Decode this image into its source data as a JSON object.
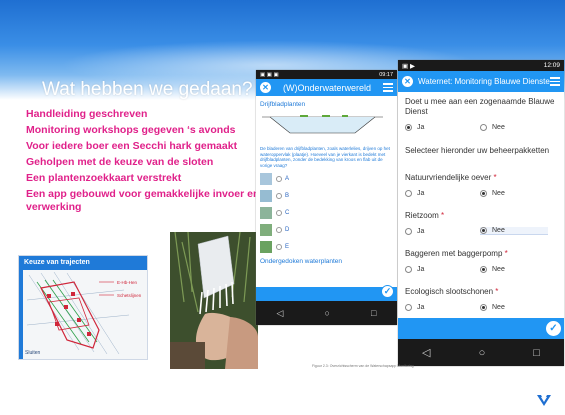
{
  "slide": {
    "title": "Wat hebben we gedaan?",
    "bullets": [
      "Handleiding geschreven",
      "Monitoring workshops gegeven ‘s avonds",
      "Voor iedere boer een Secchi hark gemaakt",
      "Geholpen met de keuze van de sloten",
      "Een plantenzoekkaart verstrekt",
      "Een app gebouwd voor gemakkelijke invoer en verwerking"
    ],
    "caption": "Figuur 2.3: Overzichtsscherm van de Waterschapsapp Monitoring",
    "colors": {
      "accent": "#e0218a",
      "band": "#1f6fd1"
    }
  },
  "map_shot": {
    "header": "Keuze van trajecten",
    "legend_1": "E-Hb-Hen",
    "legend_2": "Schetslijnen",
    "footer": "Sluiten"
  },
  "phone1": {
    "status_time": "09:17",
    "title": "(W)Onderwaterwereld",
    "section": "Drijfbladplanten",
    "question": "De bladeren van drijfbladplanten, zoals waterlelies, drijven op het wateroppervlak (plaatje). Hoeveel van je vierkant is bedekt met drijfbladplanten, zonder de bedekking van kroos en flab uit de vorige vraag?",
    "options": [
      "A",
      "B",
      "C",
      "D",
      "E"
    ],
    "section2": "Ondergedoken waterplanten",
    "nav": [
      "◁",
      "○",
      "□"
    ]
  },
  "phone2": {
    "status_time": "12:09",
    "title": "Waternet: Monitoring Blauwe Diensten",
    "questions": [
      {
        "label": "Doet u mee aan een zogenaamde Blauwe Dienst",
        "req": "",
        "yes": "Ja",
        "no": "Nee",
        "selected": "yes"
      },
      {
        "label": "Selecteer hieronder uw beheerpakketten",
        "req": ""
      },
      {
        "label": "Natuurvriendelijke oever",
        "req": "*",
        "yes": "Ja",
        "no": "Nee",
        "selected": "no"
      },
      {
        "label": "Rietzoom",
        "req": "*",
        "yes": "Ja",
        "no": "Nee",
        "selected": "no"
      },
      {
        "label": "Baggeren met baggerpomp",
        "req": "*",
        "yes": "Ja",
        "no": "Nee",
        "selected": "no"
      },
      {
        "label": "Ecologisch slootschonen",
        "req": "*",
        "yes": "Ja",
        "no": "Nee",
        "selected": "no"
      }
    ],
    "nav": [
      "◁",
      "○",
      "□"
    ]
  }
}
